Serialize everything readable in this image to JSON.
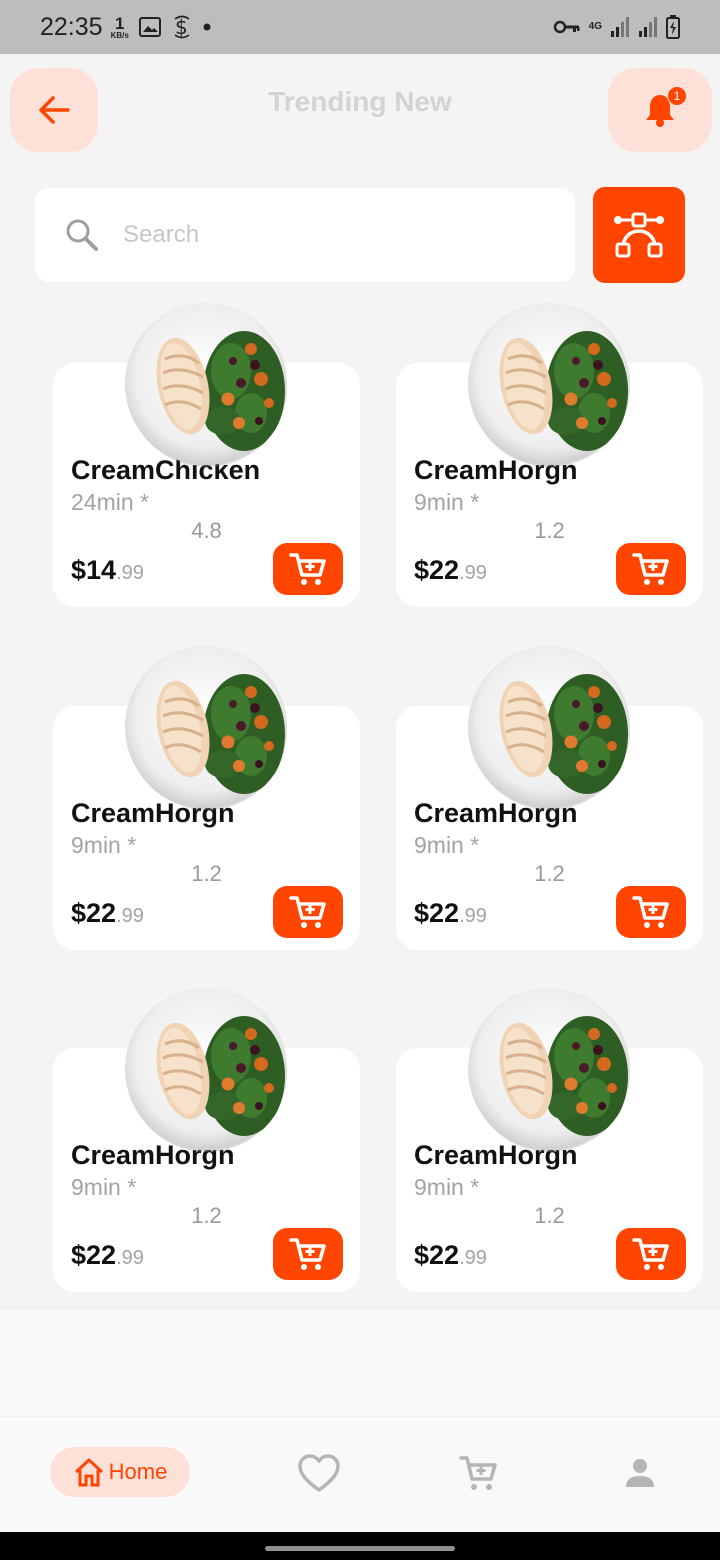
{
  "status_bar": {
    "time": "22:35",
    "net_speed_value": "1",
    "net_speed_unit": "KB/s",
    "network_label": "4G"
  },
  "header": {
    "title": "Trending New",
    "notification_count": "1"
  },
  "search": {
    "placeholder": "Search"
  },
  "colors": {
    "accent": "#ff4500",
    "accent_light": "#fde1d8",
    "background": "#f4f4f4"
  },
  "products": [
    {
      "name": "CreamChicken",
      "time": "24min *",
      "rating": "4.8",
      "price_main": "$14",
      "price_cents": ".99"
    },
    {
      "name": "CreamHorgn",
      "time": "9min *",
      "rating": "1.2",
      "price_main": "$22",
      "price_cents": ".99"
    },
    {
      "name": "CreamHorgn",
      "time": "9min *",
      "rating": "1.2",
      "price_main": "$22",
      "price_cents": ".99"
    },
    {
      "name": "CreamHorgn",
      "time": "9min *",
      "rating": "1.2",
      "price_main": "$22",
      "price_cents": ".99"
    },
    {
      "name": "CreamHorgn",
      "time": "9min *",
      "rating": "1.2",
      "price_main": "$22",
      "price_cents": ".99"
    },
    {
      "name": "CreamHorgn",
      "time": "9min *",
      "rating": "1.2",
      "price_main": "$22",
      "price_cents": ".99"
    }
  ],
  "bottom_nav": {
    "home_label": "Home",
    "icons": [
      "home-icon",
      "heart-icon",
      "cart-icon",
      "person-icon"
    ]
  }
}
